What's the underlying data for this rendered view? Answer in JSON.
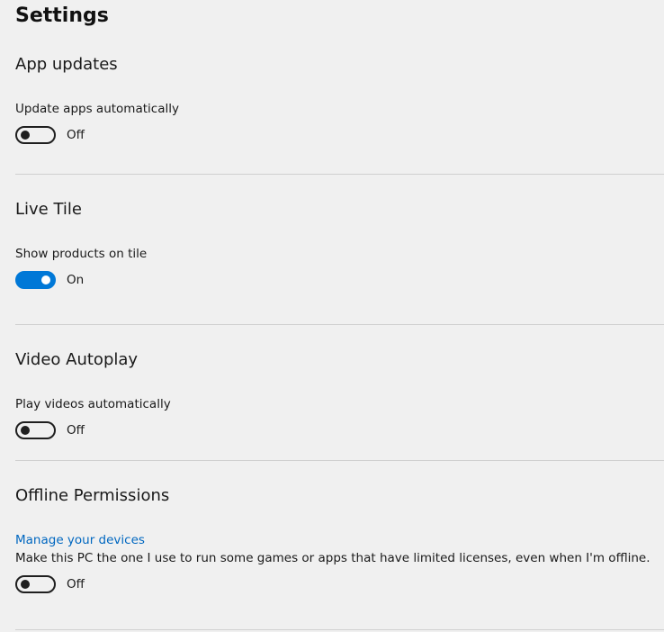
{
  "page": {
    "title": "Settings"
  },
  "sections": [
    {
      "title": "App updates",
      "label": "Update apps automatically",
      "toggle_state": "Off",
      "toggle_on": false
    },
    {
      "title": "Live Tile",
      "label": "Show products on tile",
      "toggle_state": "On",
      "toggle_on": true
    },
    {
      "title": "Video Autoplay",
      "label": "Play videos automatically",
      "toggle_state": "Off",
      "toggle_on": false
    },
    {
      "title": "Offline Permissions",
      "link": "Manage your devices",
      "label": "Make this PC the one I use to run some games or apps that have limited licenses, even when I'm offline.",
      "toggle_state": "Off",
      "toggle_on": false
    }
  ],
  "colors": {
    "accent": "#0078d7",
    "link": "#0067c0",
    "background": "#f0f0f0"
  }
}
